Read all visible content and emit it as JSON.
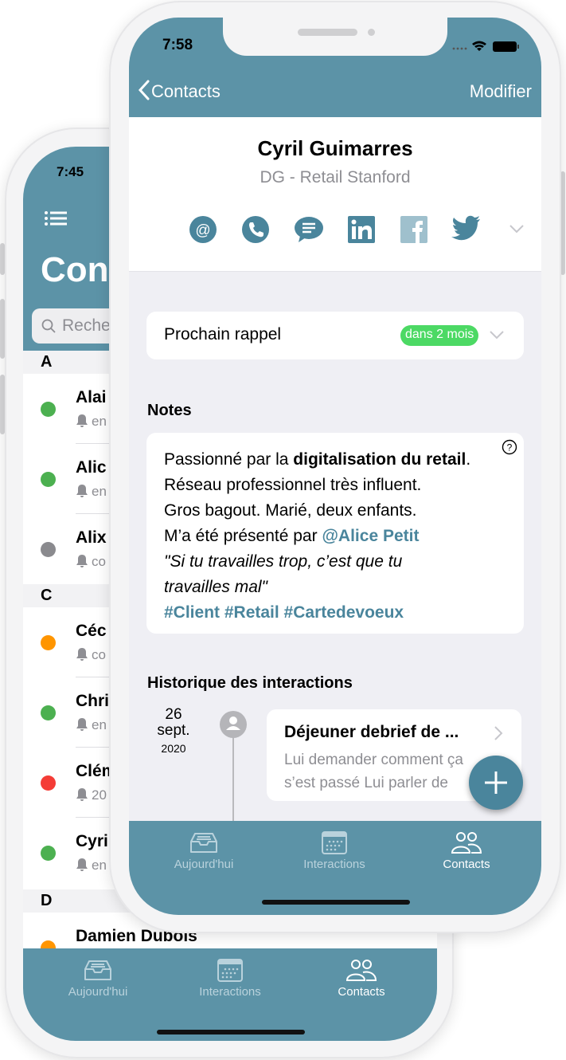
{
  "back_phone": {
    "status_time": "7:45",
    "title": "Con",
    "search_placeholder": "Reche",
    "sections": [
      {
        "letter": "A",
        "contacts": [
          {
            "name": "Alai",
            "sub": "en",
            "status": "#4cb050"
          },
          {
            "name": "Alic",
            "sub": "en",
            "status": "#4cb050"
          },
          {
            "name": "Alix",
            "sub": "co",
            "status": "#8a8a8e"
          }
        ]
      },
      {
        "letter": "C",
        "contacts": [
          {
            "name": "Céc",
            "sub": "co",
            "status": "#ff9500"
          },
          {
            "name": "Chri",
            "sub": "en",
            "status": "#4cb050"
          },
          {
            "name": "Clém",
            "sub": "20",
            "status": "#f43c36"
          },
          {
            "name": "Cyri",
            "sub": "en",
            "status": "#4cb050"
          }
        ]
      },
      {
        "letter": "D",
        "contacts": [
          {
            "name": "Damien Dubois",
            "status": "#ff9500"
          }
        ]
      }
    ],
    "tabs": [
      {
        "label": "Aujourd'hui",
        "icon": "inbox-icon"
      },
      {
        "label": "Interactions",
        "icon": "calendar-icon"
      },
      {
        "label": "Contacts",
        "icon": "contacts-icon",
        "active": true
      }
    ]
  },
  "front_phone": {
    "status_time": "7:58",
    "nav": {
      "back_label": "Contacts",
      "edit_label": "Modifier"
    },
    "contact": {
      "name": "Cyril Guimarres",
      "role": "DG - Retail Stanford"
    },
    "actions": [
      "email-icon",
      "phone-icon",
      "message-icon",
      "linkedin-icon",
      "facebook-icon",
      "twitter-icon"
    ],
    "reminder": {
      "label": "Prochain rappel",
      "badge": "dans 2 mois"
    },
    "notes": {
      "title": "Notes",
      "line1_pre": "Passionné par la ",
      "line1_bold": "digitalisation du retail",
      "line2": "Réseau professionnel très influent.",
      "line3": "Gros bagout. Marié, deux enfants.",
      "line4_pre": "M’a été présenté par ",
      "line4_mention": "@Alice Petit",
      "quote1": "\"Si tu travailles trop, c’est que tu",
      "quote2": "travailles mal\"",
      "tags": "#Client #Retail #Cartedevoeux"
    },
    "history": {
      "title": "Historique des interactions",
      "items": [
        {
          "day": "26",
          "month": "sept.",
          "year": "2020",
          "title": "Déjeuner debrief de ...",
          "line1": "Lui demander comment ça",
          "line2": "s’est passé Lui parler de"
        }
      ]
    },
    "tabs": [
      {
        "label": "Aujourd'hui",
        "icon": "inbox-icon"
      },
      {
        "label": "Interactions",
        "icon": "calendar-icon"
      },
      {
        "label": "Contacts",
        "icon": "contacts-icon",
        "active": true
      }
    ]
  },
  "colors": {
    "accent": "#5c93a7",
    "icon": "#4a859c",
    "badge": "#4cd964",
    "link": "#4a859c"
  }
}
